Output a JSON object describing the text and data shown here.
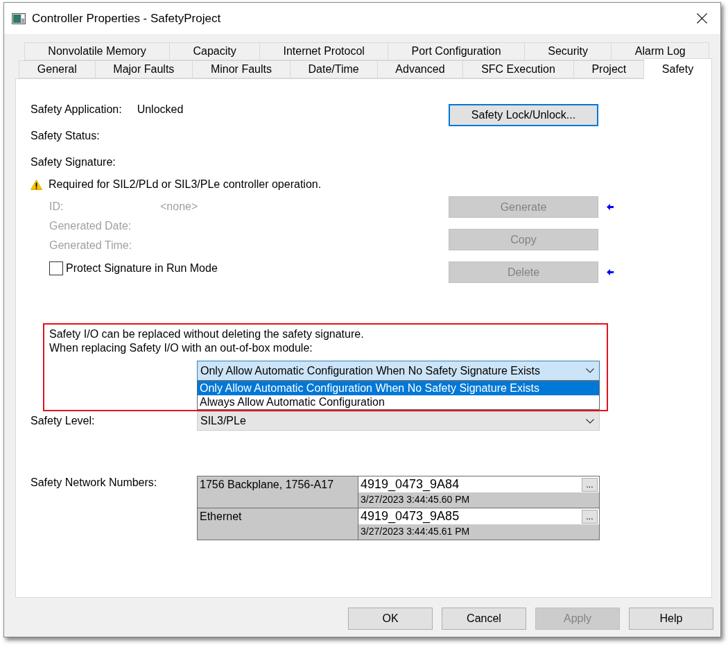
{
  "window": {
    "title": "Controller Properties - SafetyProject"
  },
  "tab_rows": [
    {
      "tabs": [
        {
          "label": "Nonvolatile Memory",
          "selected": false
        },
        {
          "label": "Capacity",
          "selected": false
        },
        {
          "label": "Internet Protocol",
          "selected": false
        },
        {
          "label": "Port Configuration",
          "selected": false
        },
        {
          "label": "Security",
          "selected": false
        },
        {
          "label": "Alarm Log",
          "selected": false
        }
      ]
    },
    {
      "tabs": [
        {
          "label": "General",
          "selected": false
        },
        {
          "label": "Major Faults",
          "selected": false
        },
        {
          "label": "Minor Faults",
          "selected": false
        },
        {
          "label": "Date/Time",
          "selected": false
        },
        {
          "label": "Advanced",
          "selected": false
        },
        {
          "label": "SFC Execution",
          "selected": false
        },
        {
          "label": "Project",
          "selected": false
        },
        {
          "label": "Safety",
          "selected": true
        }
      ]
    }
  ],
  "safety_application": {
    "label": "Safety Application:",
    "value": "Unlocked"
  },
  "lock_button": {
    "label": "Safety Lock/Unlock...",
    "focused": true
  },
  "safety_status": {
    "label": "Safety Status:"
  },
  "safety_signature": {
    "label": "Safety Signature:",
    "warning": "Required for SIL2/PLd or SIL3/PLe controller operation.",
    "fields": [
      {
        "label": "ID:",
        "value": "<none>",
        "disabled": true
      },
      {
        "label": "Generated Date:",
        "disabled": true
      },
      {
        "label": "Generated Time:",
        "disabled": true
      }
    ],
    "protect_in_run_mode": {
      "label": "Protect Signature in Run Mode",
      "checked": false
    }
  },
  "signature_buttons": [
    {
      "label": "Generate",
      "disabled": true,
      "marker": true
    },
    {
      "label": "Copy",
      "disabled": true,
      "marker": false
    },
    {
      "label": "Delete",
      "disabled": true,
      "marker": true
    }
  ],
  "io_replacement": {
    "lines": [
      "Safety I/O can be replaced without deleting the safety signature.",
      "When replacing Safety I/O with an out-of-box module:"
    ],
    "select": {
      "value": "Only Allow Automatic Configuration When No Safety Signature Exists",
      "expanded": true,
      "options": [
        {
          "label": "Only Allow Automatic Configuration When No Safety Signature Exists",
          "selected": true
        },
        {
          "label": "Always Allow Automatic Configuration",
          "selected": false
        }
      ]
    }
  },
  "safety_level": {
    "label": "Safety Level:",
    "value": "SIL3/PLe"
  },
  "safety_network_numbers": {
    "label": "Safety Network Numbers:",
    "rows": [
      {
        "name": "1756 Backplane, 1756-A17",
        "number": "4919_0473_9A84",
        "button": "...",
        "timestamp": "3/27/2023 3:44:45.60 PM"
      },
      {
        "name": "Ethernet",
        "number": "4919_0473_9A85",
        "button": "...",
        "timestamp": "3/27/2023 3:44:45.61 PM"
      }
    ]
  },
  "buttons": [
    {
      "label": "OK",
      "disabled": false
    },
    {
      "label": "Cancel",
      "disabled": false
    },
    {
      "label": "Apply",
      "disabled": true
    },
    {
      "label": "Help",
      "disabled": false
    }
  ]
}
